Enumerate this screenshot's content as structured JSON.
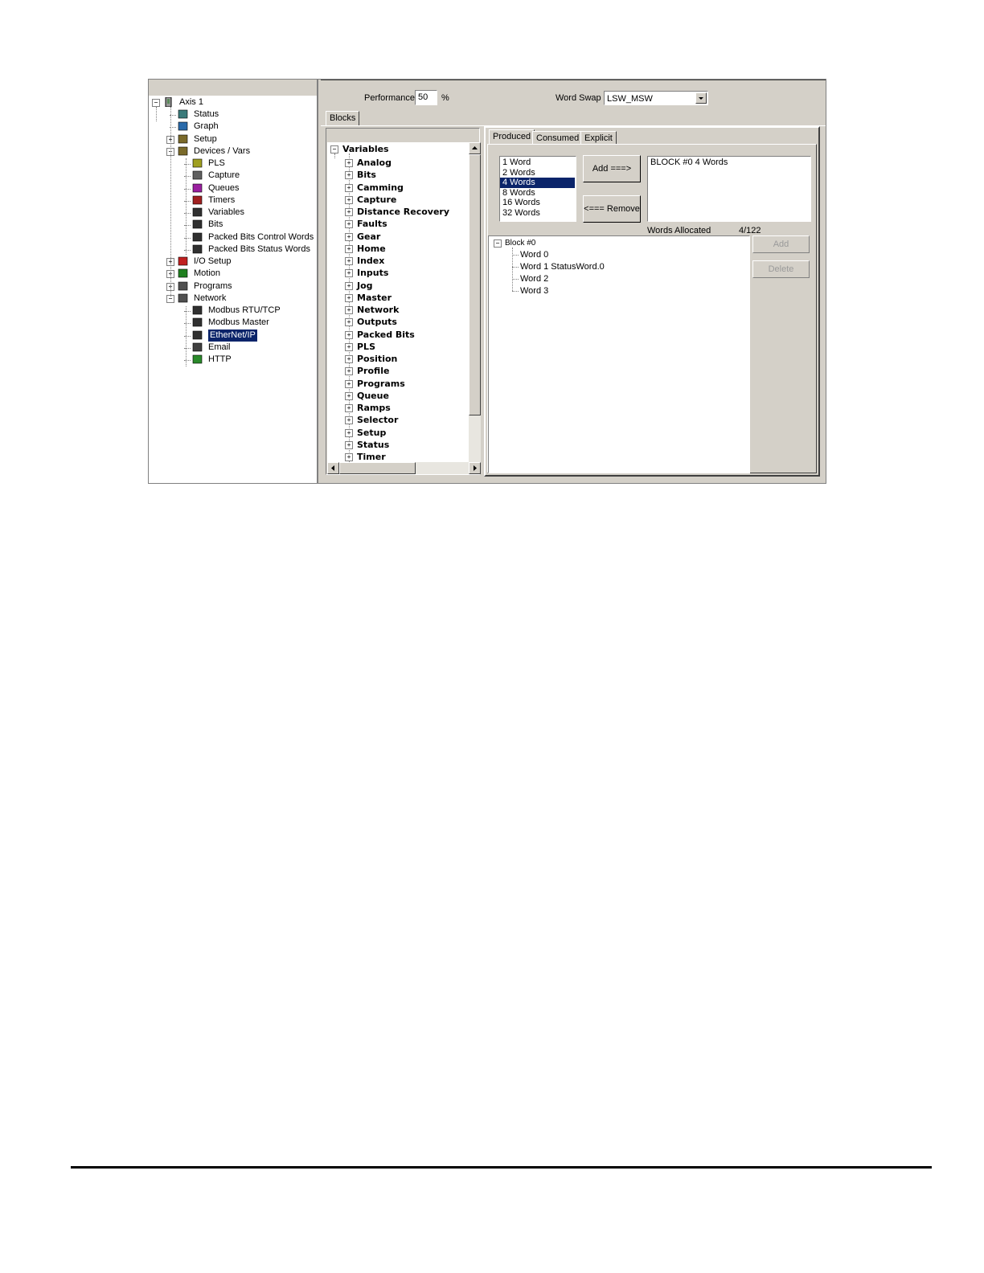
{
  "left_tree": {
    "root": "Axis 1",
    "items": [
      {
        "label": "Status",
        "icon": "status-icon"
      },
      {
        "label": "Graph",
        "icon": "graph-icon"
      },
      {
        "label": "Setup",
        "icon": "setup-icon"
      },
      {
        "label": "Devices / Vars",
        "icon": "devices-icon"
      },
      {
        "label": "PLS",
        "icon": "pls-icon"
      },
      {
        "label": "Capture",
        "icon": "capture-icon"
      },
      {
        "label": "Queues",
        "icon": "queues-icon"
      },
      {
        "label": "Timers",
        "icon": "timers-icon"
      },
      {
        "label": "Variables",
        "icon": "variables-icon"
      },
      {
        "label": "Bits",
        "icon": "bits-icon"
      },
      {
        "label": "Packed Bits Control Words",
        "icon": "packed-bits-icon"
      },
      {
        "label": "Packed Bits Status Words",
        "icon": "packed-bits-icon"
      },
      {
        "label": "I/O Setup",
        "icon": "io-setup-icon"
      },
      {
        "label": "Motion",
        "icon": "motion-icon"
      },
      {
        "label": "Programs",
        "icon": "programs-icon"
      },
      {
        "label": "Network",
        "icon": "network-icon"
      },
      {
        "label": "Modbus RTU/TCP",
        "icon": "modbus-icon"
      },
      {
        "label": "Modbus Master",
        "icon": "modbus-icon"
      },
      {
        "label": "EtherNet/IP",
        "icon": "ethernet-ip-icon"
      },
      {
        "label": "Email",
        "icon": "email-icon"
      },
      {
        "label": "HTTP",
        "icon": "http-icon"
      }
    ]
  },
  "top": {
    "performance_label": "Performance",
    "performance_value": "50",
    "performance_unit": "%",
    "word_swap_label": "Word Swap",
    "word_swap_value": "LSW_MSW"
  },
  "blocks_tab": "Blocks",
  "variables_tree": {
    "root": "Variables",
    "items": [
      "Analog",
      "Bits",
      "Camming",
      "Capture",
      "Distance Recovery",
      "Faults",
      "Gear",
      "Home",
      "Index",
      "Inputs",
      "Jog",
      "Master",
      "Network",
      "Outputs",
      "Packed Bits",
      "PLS",
      "Position",
      "Profile",
      "Programs",
      "Queue",
      "Ramps",
      "Selector",
      "Setup",
      "Status",
      "Timer"
    ]
  },
  "tabs": [
    "Produced",
    "Consumed",
    "Explicit"
  ],
  "size_list": [
    "1  Word",
    "2  Words",
    "4  Words",
    "8  Words",
    "16  Words",
    "32  Words"
  ],
  "size_selected": "4  Words",
  "add_button": "Add ===>",
  "remove_button": "<=== Remove",
  "block_list": [
    "BLOCK #0  4 Words"
  ],
  "words_allocated_label": "Words Allocated",
  "words_allocated_value": "4/122",
  "block_tree": {
    "root": "Block #0",
    "words": [
      "Word 0",
      "Word 1  StatusWord.0",
      "Word 2",
      "Word 3"
    ]
  },
  "side_add_button": "Add",
  "side_delete_button": "Delete",
  "colors": {
    "selection": "#0a246a",
    "face": "#d4d0c8",
    "shadow": "#808080"
  }
}
